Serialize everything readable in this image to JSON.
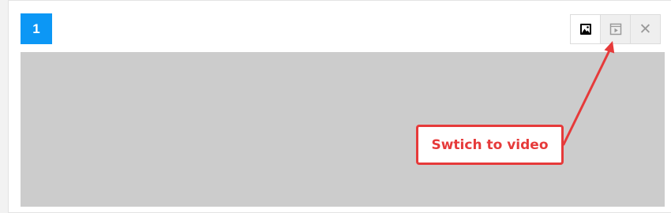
{
  "slide": {
    "number": "1"
  },
  "toolbar": {
    "buttons": [
      {
        "icon": "image-icon",
        "state": "active"
      },
      {
        "icon": "video-icon",
        "state": "inactive"
      },
      {
        "icon": "close-icon",
        "symbol": "✕",
        "state": "inactive"
      }
    ]
  },
  "annotation": {
    "text": "Swtich to video",
    "color": "#e63a3a"
  },
  "colors": {
    "accent": "#0c97f5",
    "placeholder": "#cccccc",
    "annotation": "#e63a3a"
  }
}
